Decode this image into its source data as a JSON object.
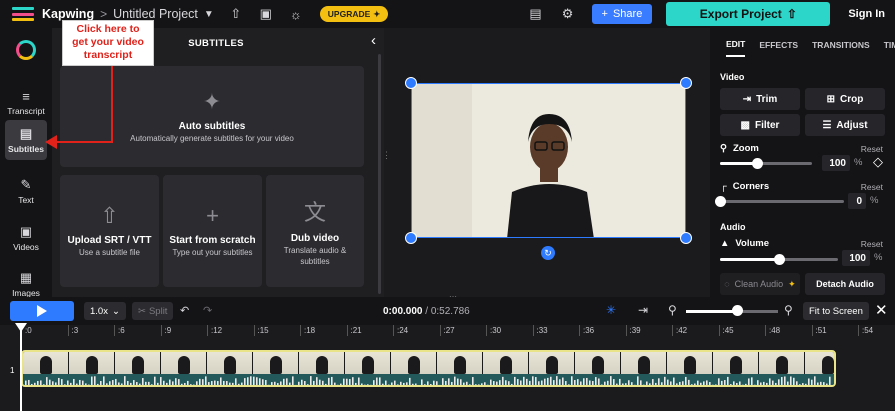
{
  "header": {
    "brand": "Kapwing",
    "breadcrumb_sep": ">",
    "project_name": "Untitled Project",
    "upgrade_label": "UPGRADE",
    "share_label": "Share",
    "export_label": "Export Project",
    "signin_label": "Sign In"
  },
  "rail": {
    "items": [
      {
        "label": "Transcript",
        "icon": "transcript-icon"
      },
      {
        "label": "Subtitles",
        "icon": "subtitles-icon"
      },
      {
        "label": "Text",
        "icon": "text-icon"
      },
      {
        "label": "Videos",
        "icon": "videos-icon"
      },
      {
        "label": "Images",
        "icon": "images-icon"
      }
    ],
    "active": "Subtitles"
  },
  "annotation": {
    "line1": "Click here to",
    "line2": "get your video",
    "line3": "transcript"
  },
  "subtitles_panel": {
    "title": "SUBTITLES",
    "auto": {
      "title": "Auto subtitles",
      "subtitle": "Automatically generate subtitles for your video"
    },
    "upload": {
      "title": "Upload SRT / VTT",
      "subtitle": "Use a subtitle file"
    },
    "scratch": {
      "title": "Start from scratch",
      "subtitle": "Type out your subtitles"
    },
    "dub": {
      "title": "Dub video",
      "subtitle": "Translate audio & subtitles"
    }
  },
  "right_panel": {
    "tabs": [
      "EDIT",
      "EFFECTS",
      "TRANSITIONS",
      "TIMING"
    ],
    "video_section": "Video",
    "trim_label": "Trim",
    "crop_label": "Crop",
    "filter_label": "Filter",
    "adjust_label": "Adjust",
    "zoom_label": "Zoom",
    "zoom_reset": "Reset",
    "zoom_value": "100",
    "zoom_unit": "%",
    "zoom_level": 0.4,
    "corners_label": "Corners",
    "corners_reset": "Reset",
    "corners_value": "0",
    "corners_unit": "%",
    "corners_level": 0,
    "audio_section": "Audio",
    "volume_label": "Volume",
    "volume_reset": "Reset",
    "volume_value": "100",
    "volume_unit": "%",
    "volume_level": 0.5,
    "clean_audio_label": "Clean Audio",
    "detach_audio_label": "Detach Audio"
  },
  "timeline": {
    "speed": "1.0x",
    "split_label": "Split",
    "current_time": "0:00.000",
    "total_time": "/ 0:52.786",
    "fit_label": "Fit to Screen",
    "zoom_level": 0.55,
    "track_number": "1",
    "ruler": [
      ":0",
      ":3",
      ":6",
      ":9",
      ":12",
      ":15",
      ":18",
      ":21",
      ":24",
      ":27",
      ":30",
      ":33",
      ":36",
      ":39",
      ":42",
      ":45",
      ":48",
      ":51",
      ":54"
    ]
  },
  "colors": {
    "accent_blue": "#2f7bff",
    "export_teal": "#2cd6c8",
    "upgrade_yellow": "#f3c012",
    "annotation_red": "#e0221b",
    "clip_border": "#e9e48a"
  }
}
